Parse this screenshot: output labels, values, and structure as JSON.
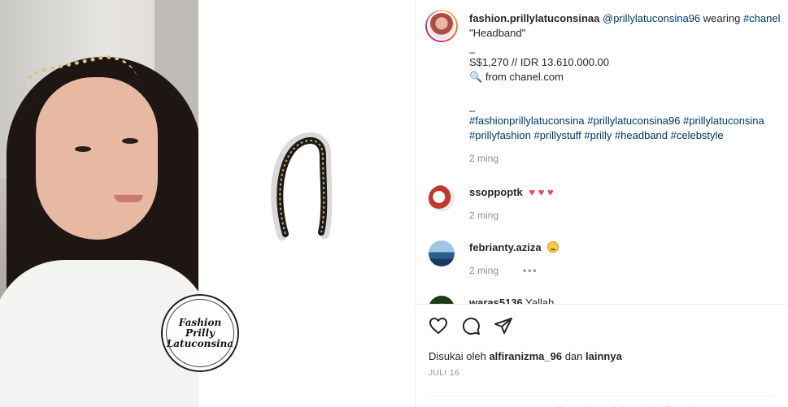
{
  "post": {
    "author": "fashion.prillylatuconsinaa",
    "mention": "@prillylatuconsina96",
    "wearing_word": "wearing",
    "brand_tag": "#chanel",
    "caption_lines": [
      "\"Headband\"",
      "_",
      "S$1,270 // IDR 13.610.000.00",
      "from chanel.com",
      "",
      "_"
    ],
    "hashtags_line1": "#fashionprillylatuconsina #prillylatuconsina96 #prillylatuconsina",
    "hashtags_line2": "#prillyfashion #prillystuff #prilly #headband #celebstyle",
    "caption_time": "2 ming",
    "search_emoji": "🔍"
  },
  "watermark": {
    "line1": "Fashion",
    "line2": "Prilly",
    "line3": "Latuconsina"
  },
  "comments": [
    {
      "user": "ssoppoptk",
      "text": "♥ ♥ ♥",
      "time": "2 ming"
    },
    {
      "user": "febrianty.aziza",
      "text": "",
      "time": "2 ming",
      "more": "•••"
    },
    {
      "user": "waras5136",
      "text": "Yallah"
    }
  ],
  "actions": {
    "liked_by_prefix": "Disukai oleh",
    "liked_by_user": "alfiranizma_96",
    "liked_by_and": "dan",
    "liked_by_others": "lainnya",
    "date": "JULI 16",
    "comments_limited": "Komentar di postingan ini sudah dibatasi."
  },
  "icons": [
    "heart-outline-icon",
    "comment-bubble-icon",
    "share-paper-plane-icon"
  ],
  "colors": {
    "link": "#00376b",
    "heart": "#ed4956",
    "muted": "#8e8e8e"
  }
}
